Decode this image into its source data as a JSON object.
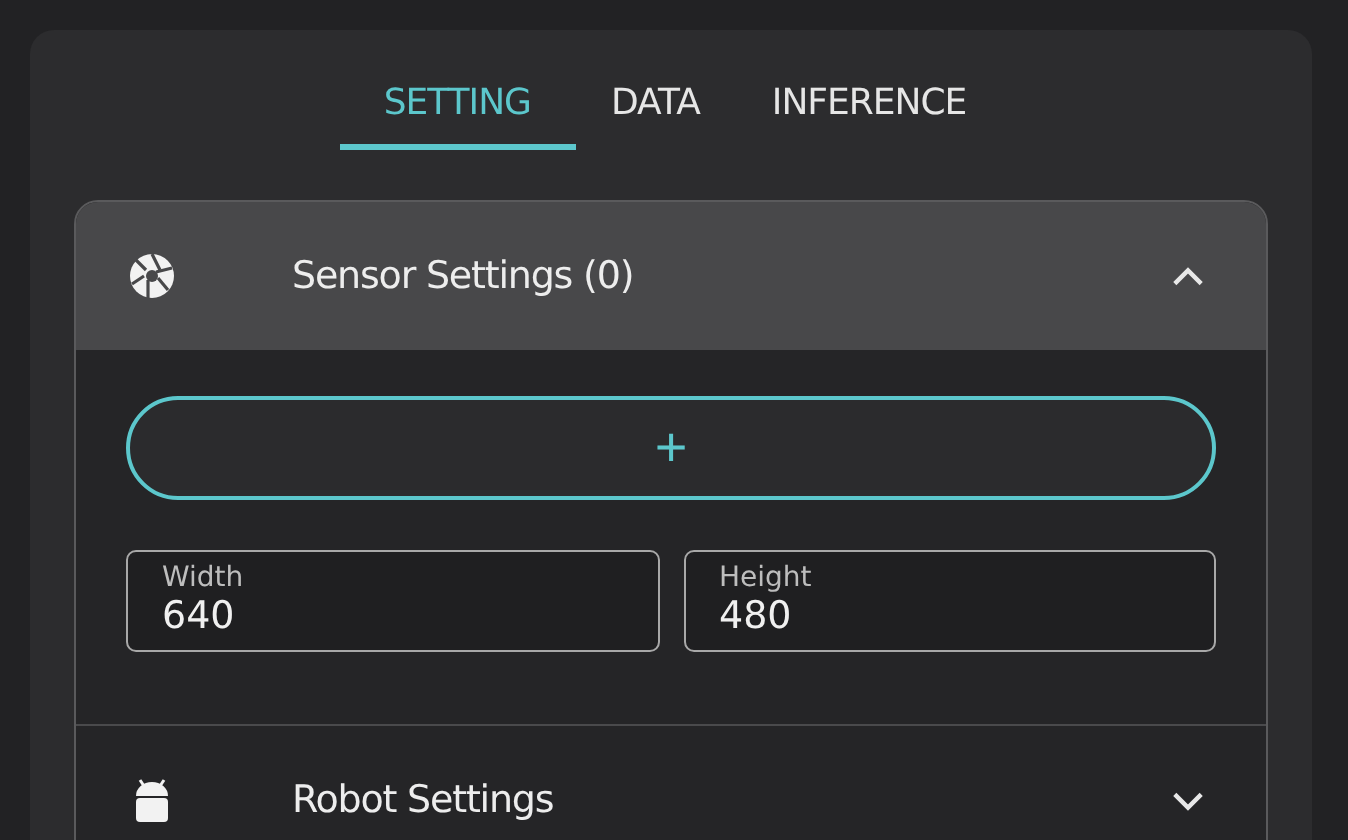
{
  "tabs": [
    {
      "label": "SETTING",
      "selected": true
    },
    {
      "label": "DATA",
      "selected": false
    },
    {
      "label": "INFERENCE",
      "selected": false
    }
  ],
  "sections": [
    {
      "title": "Sensor Settings (0)",
      "expanded": true,
      "add_button": "+",
      "fields": [
        {
          "label": "Width",
          "value": "640"
        },
        {
          "label": "Height",
          "value": "480"
        }
      ]
    },
    {
      "title": "Robot Settings",
      "expanded": false
    }
  ]
}
